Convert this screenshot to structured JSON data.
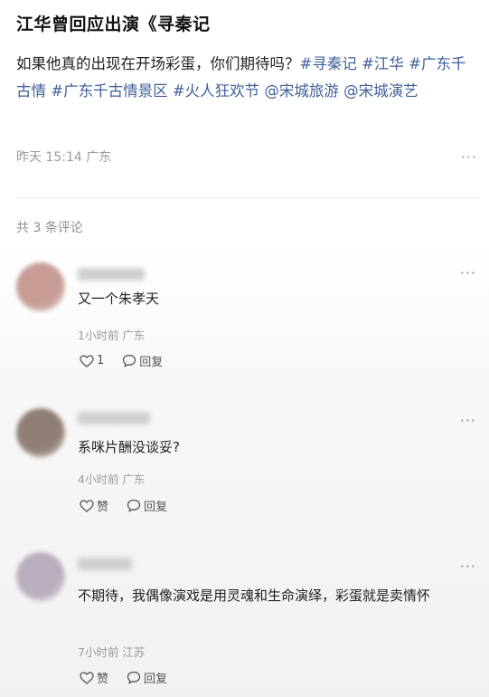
{
  "post": {
    "title": "江华曾回应出演《寻秦记",
    "body_segments": [
      {
        "text": "如果他真的出现在开场彩蛋，你们期待吗？",
        "tag": false
      },
      {
        "text": "#寻秦记 #江华 ",
        "tag": true
      },
      {
        "text": "#广东千古情 ",
        "tag": true
      },
      {
        "text": "#广东千古情景区 ",
        "tag": true
      },
      {
        "text": "#火人狂欢节 ",
        "tag": true
      },
      {
        "text": "@宋城旅游 ",
        "tag": true
      },
      {
        "text": "@宋城演艺",
        "tag": true
      }
    ],
    "meta": "昨天 15:14 广东",
    "more": "···"
  },
  "comments_header": "共 3 条评论",
  "comments": [
    {
      "avatar_color": "#c79c95",
      "text": "又一个朱孝天",
      "meta": "1小时前 广东",
      "like_label": "1",
      "reply_label": "回复",
      "more": "···"
    },
    {
      "avatar_color": "#8f7f76",
      "text": "系咪片酬没谈妥?",
      "meta": "4小时前 广东",
      "like_label": "赞",
      "reply_label": "回复",
      "more": "···"
    },
    {
      "avatar_color": "#b8aebd",
      "text": "不期待，我偶像演戏是用灵魂和生命演绎，彩蛋就是卖情怀",
      "meta": "7小时前 江苏",
      "like_label": "赞",
      "reply_label": "回复",
      "more": "···"
    }
  ]
}
